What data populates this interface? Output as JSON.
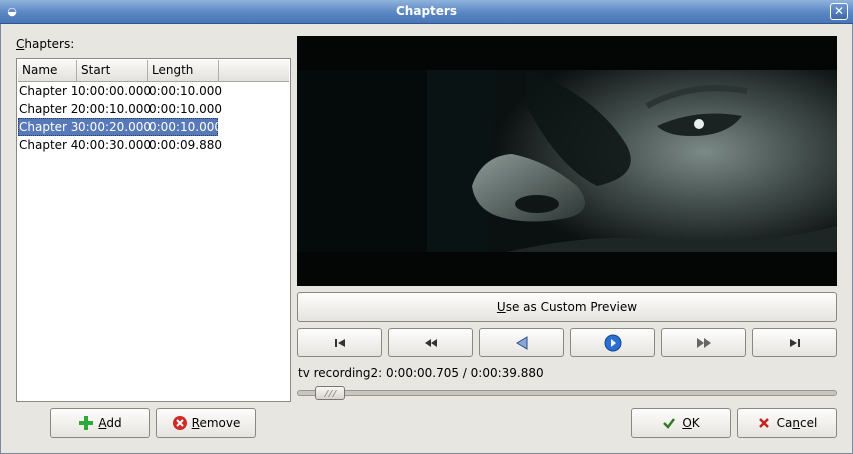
{
  "window": {
    "title": "Chapters",
    "menu_icon": "window-menu-icon",
    "close_icon": "close-icon"
  },
  "chapters_label": "Chapters:",
  "chapter_list": {
    "columns": [
      "Name",
      "Start",
      "Length"
    ],
    "rows": [
      {
        "name": "Chapter 1",
        "start": "0:00:00.000",
        "length": "0:00:10.000"
      },
      {
        "name": "Chapter 2",
        "start": "0:00:10.000",
        "length": "0:00:10.000"
      },
      {
        "name": "Chapter 3",
        "start": "0:00:20.000",
        "length": "0:00:10.000"
      },
      {
        "name": "Chapter 4",
        "start": "0:00:30.000",
        "length": "0:00:09.880"
      }
    ],
    "selected_index": 2,
    "selection_color": "#5879b8"
  },
  "preview_button": {
    "label": "Use as Custom Preview"
  },
  "transport": {
    "icons": [
      "skip-to-start-icon",
      "rewind-icon",
      "step-back-icon",
      "play-icon",
      "fast-forward-icon",
      "skip-to-end-icon"
    ]
  },
  "status": {
    "text": "tv recording2: 0:00:00.705 / 0:00:39.880"
  },
  "seek": {
    "position_fraction": 0.018
  },
  "buttons": {
    "add": {
      "label": "Add",
      "icon": "add-icon"
    },
    "remove": {
      "label": "Remove",
      "icon": "remove-icon"
    },
    "ok": {
      "label": "OK",
      "icon": "checkmark-icon"
    },
    "cancel": {
      "label": "Cancel",
      "icon": "cancel-icon"
    }
  },
  "colors": {
    "titlebar": "#5b86c3",
    "background": "#e8e6e1",
    "add_green": "#2fa83a",
    "remove_red": "#d02a25",
    "play_blue": "#2a6fd6"
  }
}
